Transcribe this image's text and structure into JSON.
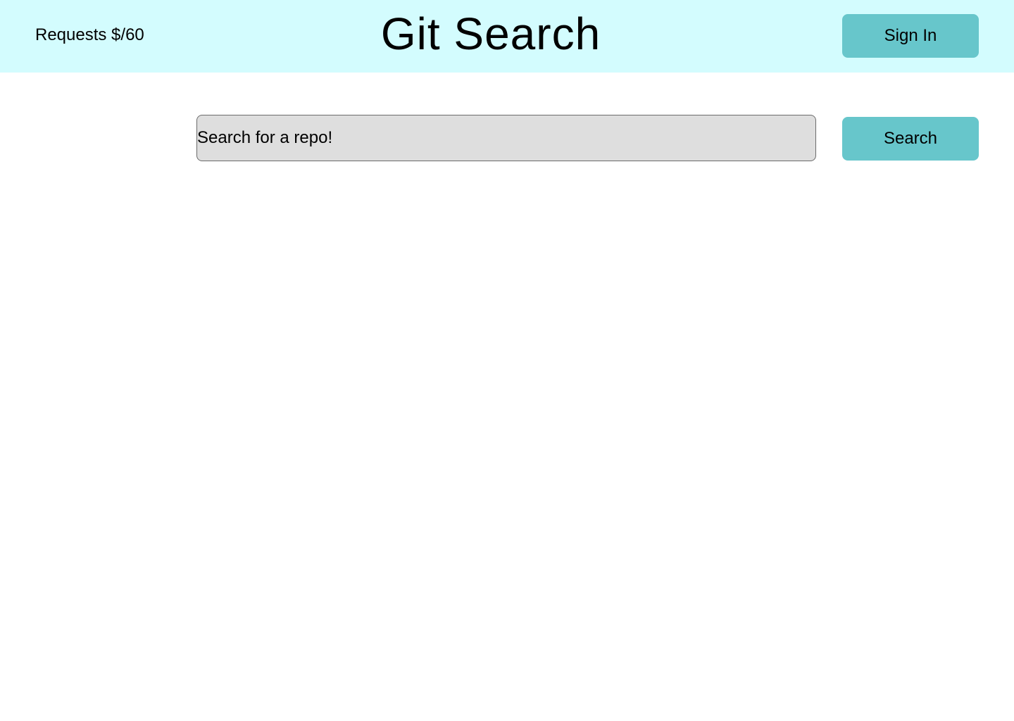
{
  "header": {
    "requests_text": "Requests $/60",
    "title": "Git Search",
    "sign_in_label": "Sign In"
  },
  "search": {
    "placeholder": "Search for a repo!",
    "value": "",
    "button_label": "Search"
  },
  "colors": {
    "header_background": "#d3fcfe",
    "button_background": "#67c6cb",
    "input_background": "#dedede",
    "input_border": "#6b6b6b",
    "page_background": "#ffffff"
  }
}
